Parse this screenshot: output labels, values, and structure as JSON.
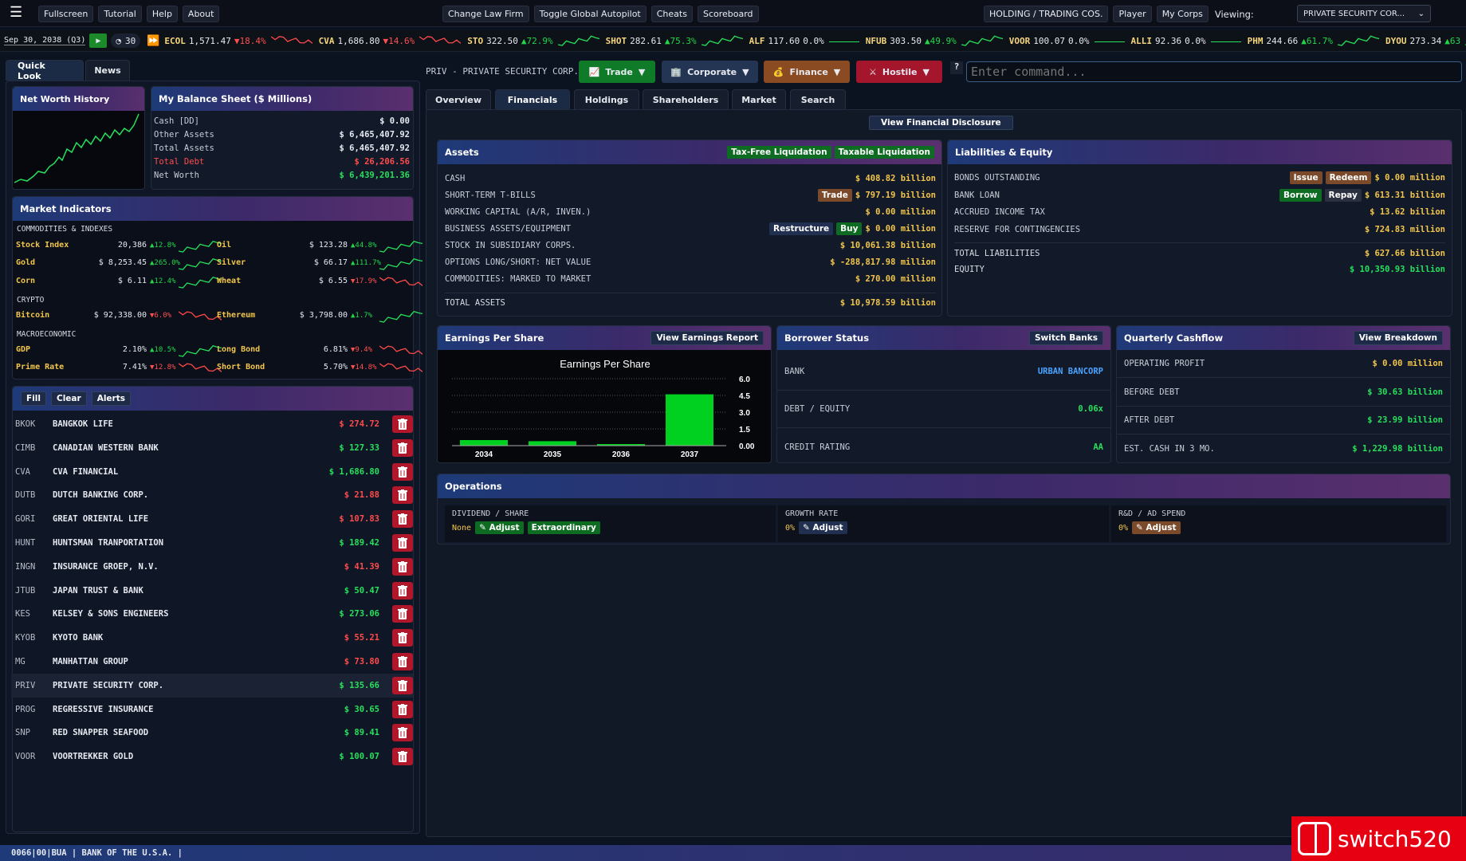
{
  "topbar": {
    "menu": [
      "Fullscreen",
      "Tutorial",
      "Help",
      "About"
    ],
    "center": [
      "Change Law Firm",
      "Toggle Global Autopilot",
      "Cheats",
      "Scoreboard"
    ],
    "right": [
      "HOLDING / TRADING COS.",
      "Player",
      "My Corps"
    ],
    "viewing_label": "Viewing:",
    "viewing_value": "PRIVATE SECURITY COR..."
  },
  "clock": {
    "date": "Sep 30, 2038 (Q3)",
    "speed": "30"
  },
  "ticker": [
    {
      "sym": "ECOL",
      "price": "1,571.47",
      "chg": "▼18.4%",
      "dir": "dn"
    },
    {
      "sym": "CVA",
      "price": "1,686.80",
      "chg": "▼14.6%",
      "dir": "dn"
    },
    {
      "sym": "STO",
      "price": "322.50",
      "chg": "▲72.9%",
      "dir": "up"
    },
    {
      "sym": "SHOT",
      "price": "282.61",
      "chg": "▲75.3%",
      "dir": "up"
    },
    {
      "sym": "ALF",
      "price": "117.60",
      "chg": "0.0%",
      "dir": "wh"
    },
    {
      "sym": "NFUB",
      "price": "303.50",
      "chg": "▲49.9%",
      "dir": "up"
    },
    {
      "sym": "VOOR",
      "price": "100.07",
      "chg": "0.0%",
      "dir": "wh"
    },
    {
      "sym": "ALLI",
      "price": "92.36",
      "chg": "0.0%",
      "dir": "wh"
    },
    {
      "sym": "PHM",
      "price": "244.66",
      "chg": "▲61.7%",
      "dir": "up"
    },
    {
      "sym": "DYOU",
      "price": "273.34",
      "chg": "▲63",
      "dir": "up"
    }
  ],
  "left_tabs": [
    "Quick Look",
    "News"
  ],
  "net_worth": {
    "title": "Net Worth History"
  },
  "balance": {
    "title": "My Balance Sheet ($ Millions)",
    "rows": [
      {
        "label": "Cash [DD]",
        "value": "$ 0.00",
        "color": "wh"
      },
      {
        "label": "Other Assets",
        "value": "$ 6,465,407.92",
        "color": "wh"
      },
      {
        "label": "Total Assets",
        "value": "$ 6,465,407.92",
        "color": "wh"
      },
      {
        "label": "Total Debt",
        "value": "$ 26,206.56",
        "color": "red"
      },
      {
        "label": "Net Worth",
        "value": "$ 6,439,201.36",
        "color": "grn"
      }
    ]
  },
  "market": {
    "title": "Market Indicators",
    "sections": [
      "COMMODITIES & INDEXES",
      "CRYPTO",
      "MACROECONOMIC"
    ],
    "items": [
      {
        "l": "Stock Index",
        "lv": "20,386",
        "lc": "▲12.8%",
        "ld": "up",
        "r": "Oil",
        "rv": "$ 123.28",
        "rc": "▲44.8%",
        "rd": "up"
      },
      {
        "l": "Gold",
        "lv": "$ 8,253.45",
        "lc": "▲265.0%",
        "ld": "up",
        "r": "Silver",
        "rv": "$ 66.17",
        "rc": "▲111.7%",
        "rd": "up"
      },
      {
        "l": "Corn",
        "lv": "$ 6.11",
        "lc": "▲12.4%",
        "ld": "up",
        "r": "Wheat",
        "rv": "$ 6.55",
        "rc": "▼17.9%",
        "rd": "dn"
      },
      {
        "l": "Bitcoin",
        "lv": "$ 92,338.00",
        "lc": "▼6.0%",
        "ld": "dn",
        "r": "Ethereum",
        "rv": "$ 3,798.00",
        "rc": "▲1.7%",
        "rd": "up"
      },
      {
        "l": "GDP",
        "lv": "2.10%",
        "lc": "▲10.5%",
        "ld": "up",
        "r": "Long Bond",
        "rv": "6.81%",
        "rc": "▼9.4%",
        "rd": "dn"
      },
      {
        "l": "Prime Rate",
        "lv": "7.41%",
        "lc": "▼12.8%",
        "ld": "dn",
        "r": "Short Bond",
        "rv": "5.70%",
        "rc": "▼14.8%",
        "rd": "dn"
      }
    ]
  },
  "watch": {
    "buttons": [
      "Fill",
      "Clear",
      "Alerts"
    ],
    "rows": [
      {
        "sym": "BKOK",
        "name": "BANGKOK LIFE",
        "price": "$ 274.72",
        "c": "red"
      },
      {
        "sym": "CIMB",
        "name": "CANADIAN WESTERN BANK",
        "price": "$ 127.33",
        "c": "grn"
      },
      {
        "sym": "CVA",
        "name": "CVA FINANCIAL",
        "price": "$ 1,686.80",
        "c": "grn"
      },
      {
        "sym": "DUTB",
        "name": "DUTCH BANKING CORP.",
        "price": "$ 21.88",
        "c": "red"
      },
      {
        "sym": "GORI",
        "name": "GREAT ORIENTAL LIFE",
        "price": "$ 107.83",
        "c": "red"
      },
      {
        "sym": "HUNT",
        "name": "HUNTSMAN TRANPORTATION",
        "price": "$ 189.42",
        "c": "grn"
      },
      {
        "sym": "INGN",
        "name": "INSURANCE GROEP, N.V.",
        "price": "$ 41.39",
        "c": "red"
      },
      {
        "sym": "JTUB",
        "name": "JAPAN TRUST & BANK",
        "price": "$ 50.47",
        "c": "grn"
      },
      {
        "sym": "KES",
        "name": "KELSEY & SONS ENGINEERS",
        "price": "$ 273.06",
        "c": "grn"
      },
      {
        "sym": "KYOB",
        "name": "KYOTO BANK",
        "price": "$ 55.21",
        "c": "red"
      },
      {
        "sym": "MG",
        "name": "MANHATTAN GROUP",
        "price": "$ 73.80",
        "c": "red"
      },
      {
        "sym": "PRIV",
        "name": "PRIVATE SECURITY CORP.",
        "price": "$ 135.66",
        "c": "grn"
      },
      {
        "sym": "PROG",
        "name": "REGRESSIVE INSURANCE",
        "price": "$ 30.65",
        "c": "grn"
      },
      {
        "sym": "SNP",
        "name": "RED SNAPPER SEAFOOD",
        "price": "$ 89.41",
        "c": "grn"
      },
      {
        "sym": "VOOR",
        "name": "VOORTREKKER GOLD",
        "price": "$ 100.07",
        "c": "grn"
      }
    ]
  },
  "corp": {
    "title": "PRIV - PRIVATE SECURITY CORP.",
    "actions": [
      "Trade",
      "Corporate",
      "Finance",
      "Hostile"
    ],
    "help": "?",
    "command_placeholder": "Enter command..."
  },
  "corp_tabs": [
    "Overview",
    "Financials",
    "Holdings",
    "Shareholders",
    "Market",
    "Search"
  ],
  "disclosure": "View Financial Disclosure",
  "assets": {
    "title": "Assets",
    "b1": "Tax-Free Liquidation",
    "b2": "Taxable Liquidation",
    "rows": [
      {
        "label": "CASH",
        "value": "$ 408.82 billion"
      },
      {
        "label": "SHORT-TERM T-BILLS",
        "value": "$ 797.19 billion",
        "btns": [
          "Trade"
        ]
      },
      {
        "label": "WORKING CAPITAL (A/R, INVEN.)",
        "value": "$ 0.00 million"
      },
      {
        "label": "BUSINESS ASSETS/EQUIPMENT",
        "value": "$ 0.00 million",
        "btns": [
          "Restructure",
          "Buy"
        ]
      },
      {
        "label": "STOCK IN SUBSIDIARY CORPS.",
        "value": "$ 10,061.38 billion"
      },
      {
        "label": "OPTIONS LONG/SHORT: NET VALUE",
        "value": "$ -288,817.98 million"
      },
      {
        "label": "COMMODITIES: MARKED TO MARKET",
        "value": "$ 270.00 million"
      }
    ],
    "total_label": "TOTAL ASSETS",
    "total_value": "$ 10,978.59 billion"
  },
  "liab": {
    "title": "Liabilities & Equity",
    "rows": [
      {
        "label": "BONDS OUTSTANDING",
        "value": "$ 0.00 million",
        "btns": [
          "Issue",
          "Redeem"
        ]
      },
      {
        "label": "BANK LOAN",
        "value": "$ 613.31 billion",
        "btns": [
          "Borrow",
          "Repay"
        ]
      },
      {
        "label": "ACCRUED INCOME TAX",
        "value": "$ 13.62 billion"
      },
      {
        "label": "RESERVE FOR CONTINGENCIES",
        "value": "$ 724.83 million"
      }
    ],
    "total_label": "TOTAL LIABILITIES",
    "total_value": "$ 627.66 billion",
    "equity_label": "EQUITY",
    "equity_value": "$ 10,350.93 billion"
  },
  "eps": {
    "title": "Earnings Per Share",
    "button": "View Earnings Report"
  },
  "chart_data": {
    "type": "bar",
    "title": "Earnings Per Share",
    "categories": [
      "2034",
      "2035",
      "2036",
      "2037"
    ],
    "values": [
      0.5,
      0.4,
      0.05,
      4.6
    ],
    "yticks": [
      "6.0",
      "4.5",
      "3.0",
      "1.5",
      "0.00"
    ],
    "ylim": [
      0,
      6
    ],
    "grid": true,
    "color": "#00d020"
  },
  "borrower": {
    "title": "Borrower Status",
    "button": "Switch Banks",
    "rows": [
      {
        "label": "BANK",
        "value": "URBAN BANCORP",
        "c": "blu"
      },
      {
        "label": "DEBT / EQUITY",
        "value": "0.06x",
        "c": "grn"
      },
      {
        "label": "CREDIT RATING",
        "value": "AA",
        "c": "grn"
      }
    ]
  },
  "cashflow": {
    "title": "Quarterly Cashflow",
    "button": "View Breakdown",
    "rows": [
      {
        "label": "OPERATING PROFIT",
        "value": "$ 0.00 million",
        "c": "yel"
      },
      {
        "label": "BEFORE DEBT",
        "value": "$ 30.63 billion",
        "c": "grn"
      },
      {
        "label": "AFTER DEBT",
        "value": "$ 23.99 billion",
        "c": "grn"
      },
      {
        "label": "EST. CASH IN 3 MO.",
        "value": "$ 1,229.98 billion",
        "c": "grn"
      }
    ]
  },
  "ops": {
    "title": "Operations",
    "div_label": "DIVIDEND / SHARE",
    "div_value": "None",
    "div_adjust": "Adjust",
    "div_extra": "Extraordinary",
    "growth_label": "GROWTH RATE",
    "growth_value": "0%",
    "growth_adjust": "Adjust",
    "rd_label": "R&D / AD SPEND",
    "rd_value": "0%",
    "rd_adjust": "Adjust"
  },
  "statusbar": "0066|00|BUA | BANK OF THE U.S.A. |",
  "watermark": "switch520"
}
